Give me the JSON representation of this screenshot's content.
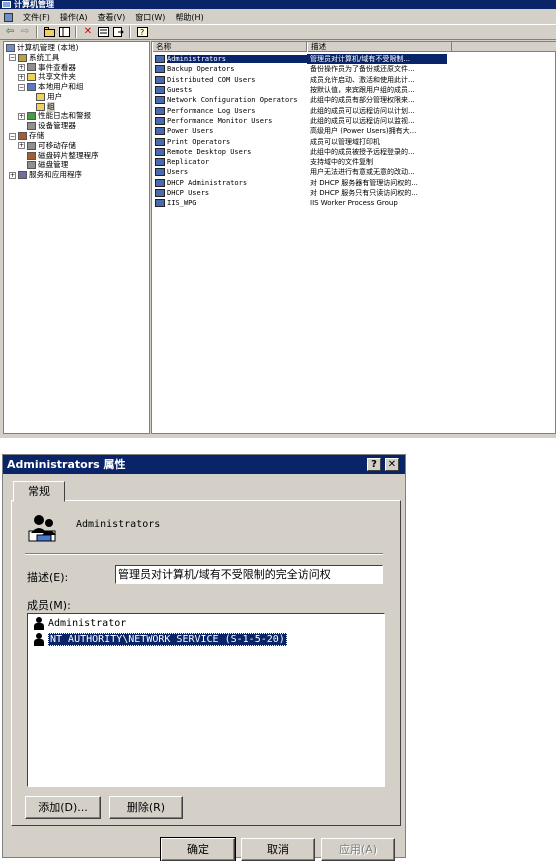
{
  "mmc": {
    "title": "计算机管理",
    "menu": [
      "文件(F)",
      "操作(A)",
      "查看(V)",
      "窗口(W)",
      "帮助(H)"
    ],
    "toolbar": [
      "back-icon",
      "forward-icon",
      "up-folder-icon",
      "show-tree-icon",
      "delete-icon",
      "properties-icon",
      "export-icon",
      "help-icon"
    ],
    "tree": [
      {
        "label": "计算机管理 (本地)",
        "level": 0,
        "expander": "",
        "icon": "computer-icon"
      },
      {
        "label": "系统工具",
        "level": 1,
        "expander": "−",
        "icon": "tools-icon"
      },
      {
        "label": "事件查看器",
        "level": 2,
        "expander": "+",
        "icon": "event-viewer-icon"
      },
      {
        "label": "共享文件夹",
        "level": 2,
        "expander": "+",
        "icon": "shared-folder-icon"
      },
      {
        "label": "本地用户和组",
        "level": 2,
        "expander": "−",
        "icon": "users-groups-icon"
      },
      {
        "label": "用户",
        "level": 3,
        "expander": "",
        "icon": "folder-icon"
      },
      {
        "label": "组",
        "level": 3,
        "expander": "",
        "icon": "folder-icon"
      },
      {
        "label": "性能日志和警报",
        "level": 2,
        "expander": "+",
        "icon": "performance-icon"
      },
      {
        "label": "设备管理器",
        "level": 2,
        "expander": "",
        "icon": "device-manager-icon"
      },
      {
        "label": "存储",
        "level": 1,
        "expander": "−",
        "icon": "storage-icon"
      },
      {
        "label": "可移动存储",
        "level": 2,
        "expander": "+",
        "icon": "removable-storage-icon"
      },
      {
        "label": "磁盘碎片整理程序",
        "level": 2,
        "expander": "",
        "icon": "defrag-icon"
      },
      {
        "label": "磁盘管理",
        "level": 2,
        "expander": "",
        "icon": "disk-management-icon"
      },
      {
        "label": "服务和应用程序",
        "level": 1,
        "expander": "+",
        "icon": "services-icon"
      }
    ],
    "list_columns": [
      "名称",
      "描述"
    ],
    "groups": [
      {
        "name": "Administrators",
        "desc": "管理员对计算机/域有不受限制..."
      },
      {
        "name": "Backup Operators",
        "desc": "备份操作员为了备份或还原文件..."
      },
      {
        "name": "Distributed COM Users",
        "desc": "成员允许启动、激活和使用此计..."
      },
      {
        "name": "Guests",
        "desc": "按默认值，来宾跟用户组的成员..."
      },
      {
        "name": "Network Configuration Operators",
        "desc": "此组中的成员有部分管理权限来..."
      },
      {
        "name": "Performance Log Users",
        "desc": "此组的成员可以远程访问以计划..."
      },
      {
        "name": "Performance Monitor Users",
        "desc": "此组的成员可以远程访问以监视..."
      },
      {
        "name": "Power Users",
        "desc": "高级用户 (Power Users)拥有大..."
      },
      {
        "name": "Print Operators",
        "desc": "成员可以管理域打印机"
      },
      {
        "name": "Remote Desktop Users",
        "desc": "此组中的成员被授予远程登录的..."
      },
      {
        "name": "Replicator",
        "desc": "支持域中的文件复制"
      },
      {
        "name": "Users",
        "desc": "用户无法进行有意或无意的改动..."
      },
      {
        "name": "DHCP Administrators",
        "desc": "对 DHCP 服务器有管理访问权的..."
      },
      {
        "name": "DHCP Users",
        "desc": "对 DHCP 服务只有只读访问权的..."
      },
      {
        "name": "IIS_WPG",
        "desc": "IIS Worker Process Group"
      }
    ]
  },
  "dialog": {
    "title": "Administrators 属性",
    "help_button": "?",
    "close_button": "✕",
    "tab_label": "常规",
    "group_name": "Administrators",
    "desc_label": "描述(E):",
    "desc_value": "管理员对计算机/域有不受限制的完全访问权",
    "members_label": "成员(M):",
    "members": [
      "Administrator",
      "NT AUTHORITY\\NETWORK SERVICE (S-1-5-20)"
    ],
    "add_button": "添加(D)...",
    "remove_button": "删除(R)",
    "ok_button": "确定",
    "cancel_button": "取消",
    "apply_button": "应用(A)"
  }
}
